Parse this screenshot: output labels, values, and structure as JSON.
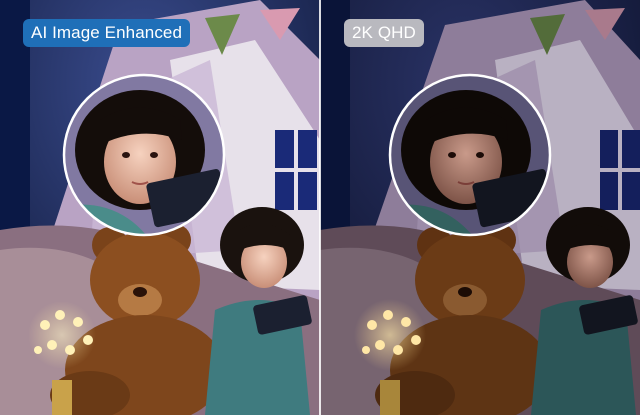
{
  "comparison": {
    "left": {
      "label": "AI Image Enhanced",
      "badge_bg": "#1f6fb8",
      "badge_text": "#ffffff",
      "tone": "brighter"
    },
    "right": {
      "label": "2K QHD",
      "badge_bg": "#b9b9bf",
      "badge_text": "#ffffff",
      "tone": "darker"
    }
  },
  "scene": {
    "subject": "child-with-tablet",
    "elements": [
      "teepee-tent",
      "teddy-bear",
      "string-lights",
      "window",
      "pennant-flags",
      "zoom-inset"
    ]
  },
  "colors": {
    "night_sky": "#0b1330",
    "tent_fabric": "#b9a3c4",
    "tent_interior": "#e7e1ea",
    "bear": "#8c4f20",
    "light_glow": "#ffe9a0",
    "inset_border": "#ffffff"
  }
}
